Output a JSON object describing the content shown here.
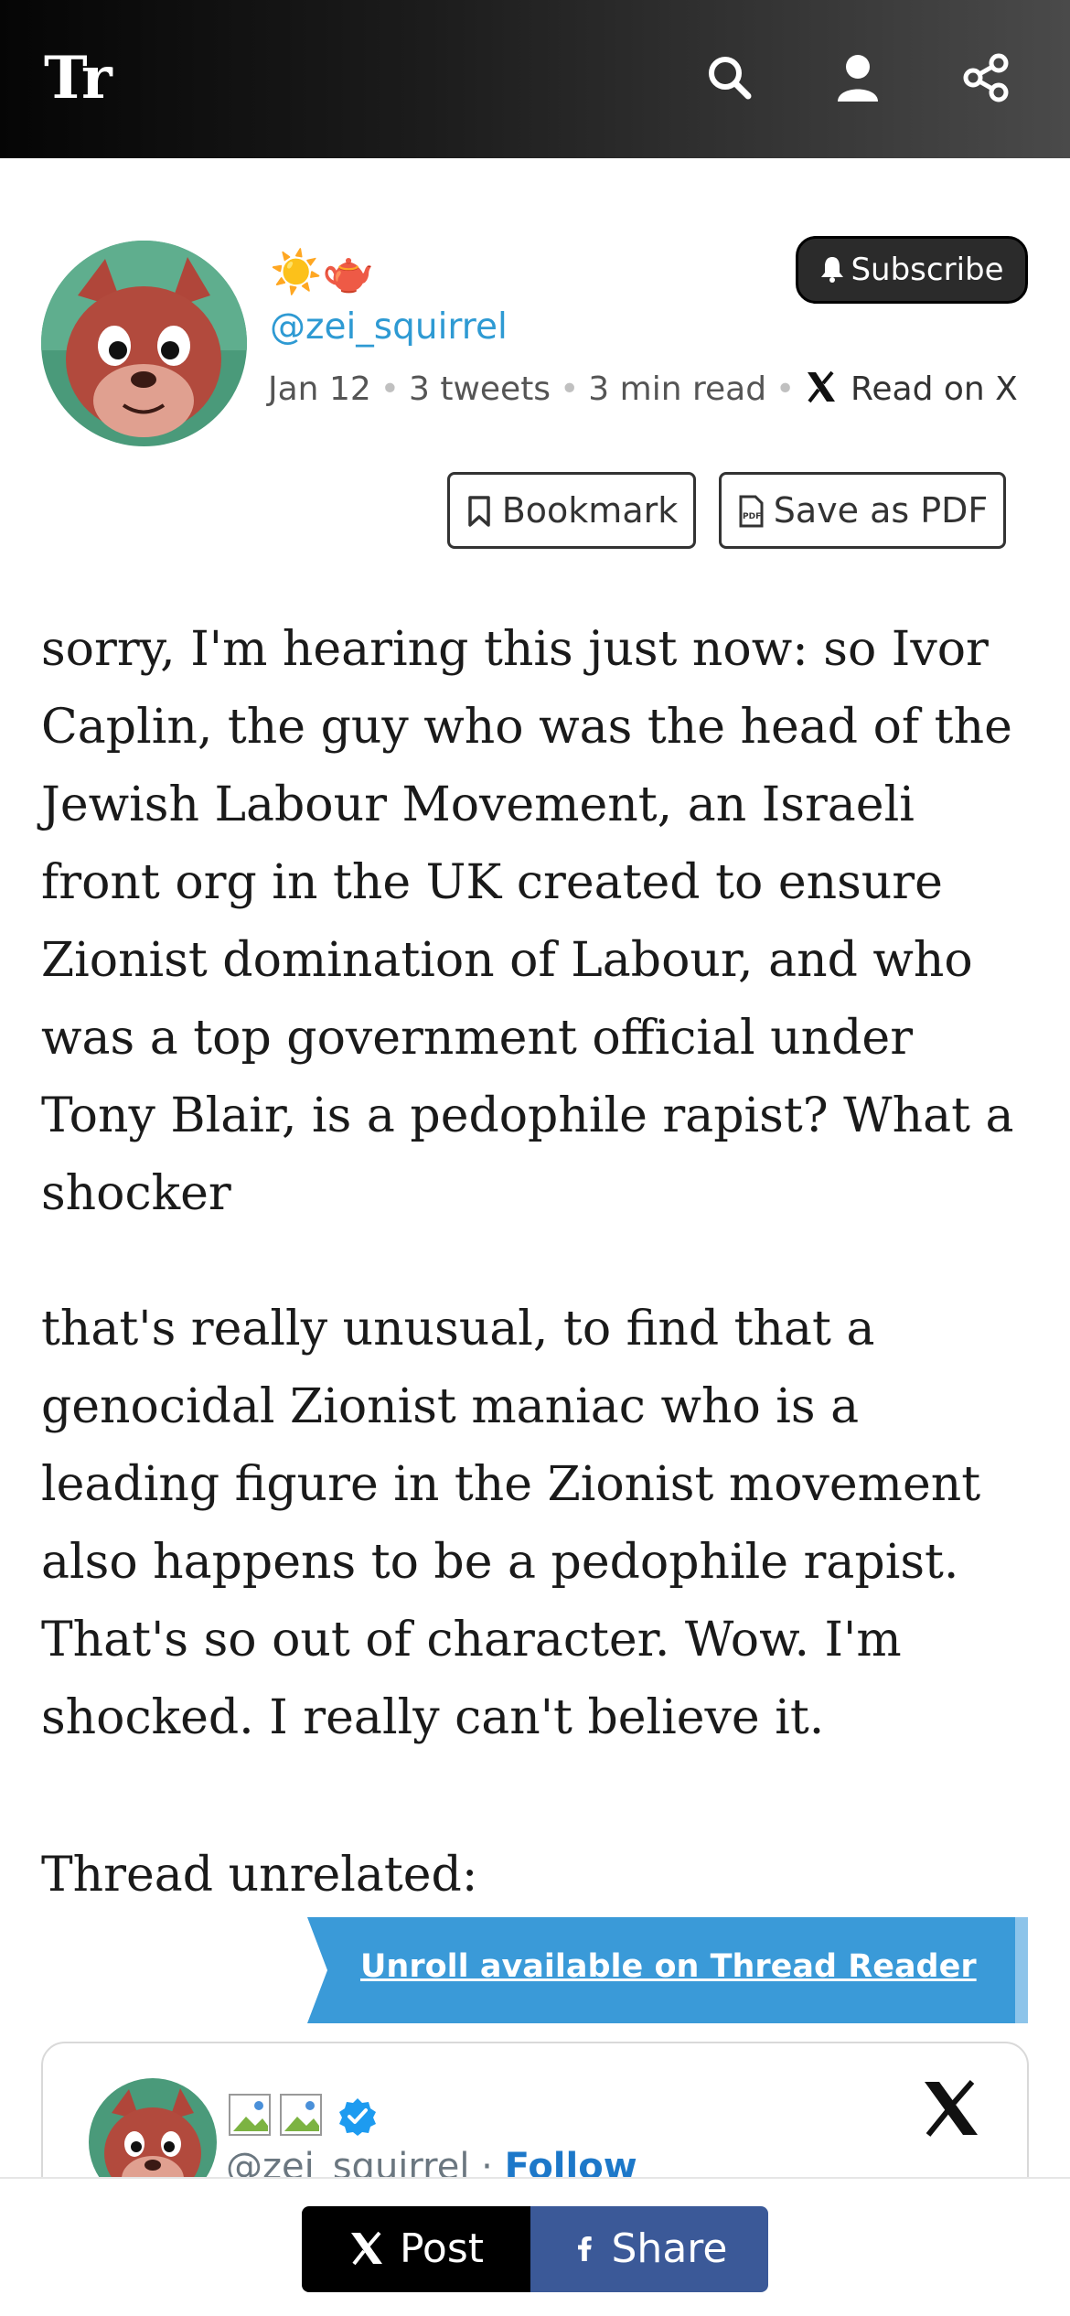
{
  "header": {
    "logo": "Tr",
    "icons": [
      "search-icon",
      "user-icon",
      "share-icon"
    ]
  },
  "author": {
    "name": "☀️🫖",
    "handle": "@zei_squirrel",
    "date": "Jan 12",
    "tweets": "3 tweets",
    "read_time": "3 min read",
    "read_on_x": "Read on X",
    "subscribe_label": "Subscribe",
    "bookmark_label": "Bookmark",
    "save_pdf_label": "Save as PDF"
  },
  "content": {
    "paragraphs": [
      "sorry, I'm hearing this just now: so Ivor Caplin, the guy who was the head of the Jewish Labour Movement, an Israeli front org in the UK created to ensure Zionist domination of Labour, and who was a top government official under Tony Blair, is a pedophile rapist? What a shocker",
      "that's really unusual, to find that a genocidal Zionist maniac who is a leading figure in the Zionist movement also happens to be a pedophile rapist. That's so out of character. Wow. I'm shocked. I really can't believe it.",
      "Thread unrelated:"
    ]
  },
  "unroll": {
    "label": "Unroll available on Thread Reader"
  },
  "embed": {
    "handle": "@zei_squirrel",
    "separator": " · ",
    "follow": "Follow"
  },
  "footer": {
    "post_label": "Post",
    "share_label": "Share"
  },
  "colors": {
    "link": "#2e9ad3",
    "unroll_bg": "#3a9ad8",
    "facebook": "#3b5998",
    "x_black": "#000000"
  }
}
